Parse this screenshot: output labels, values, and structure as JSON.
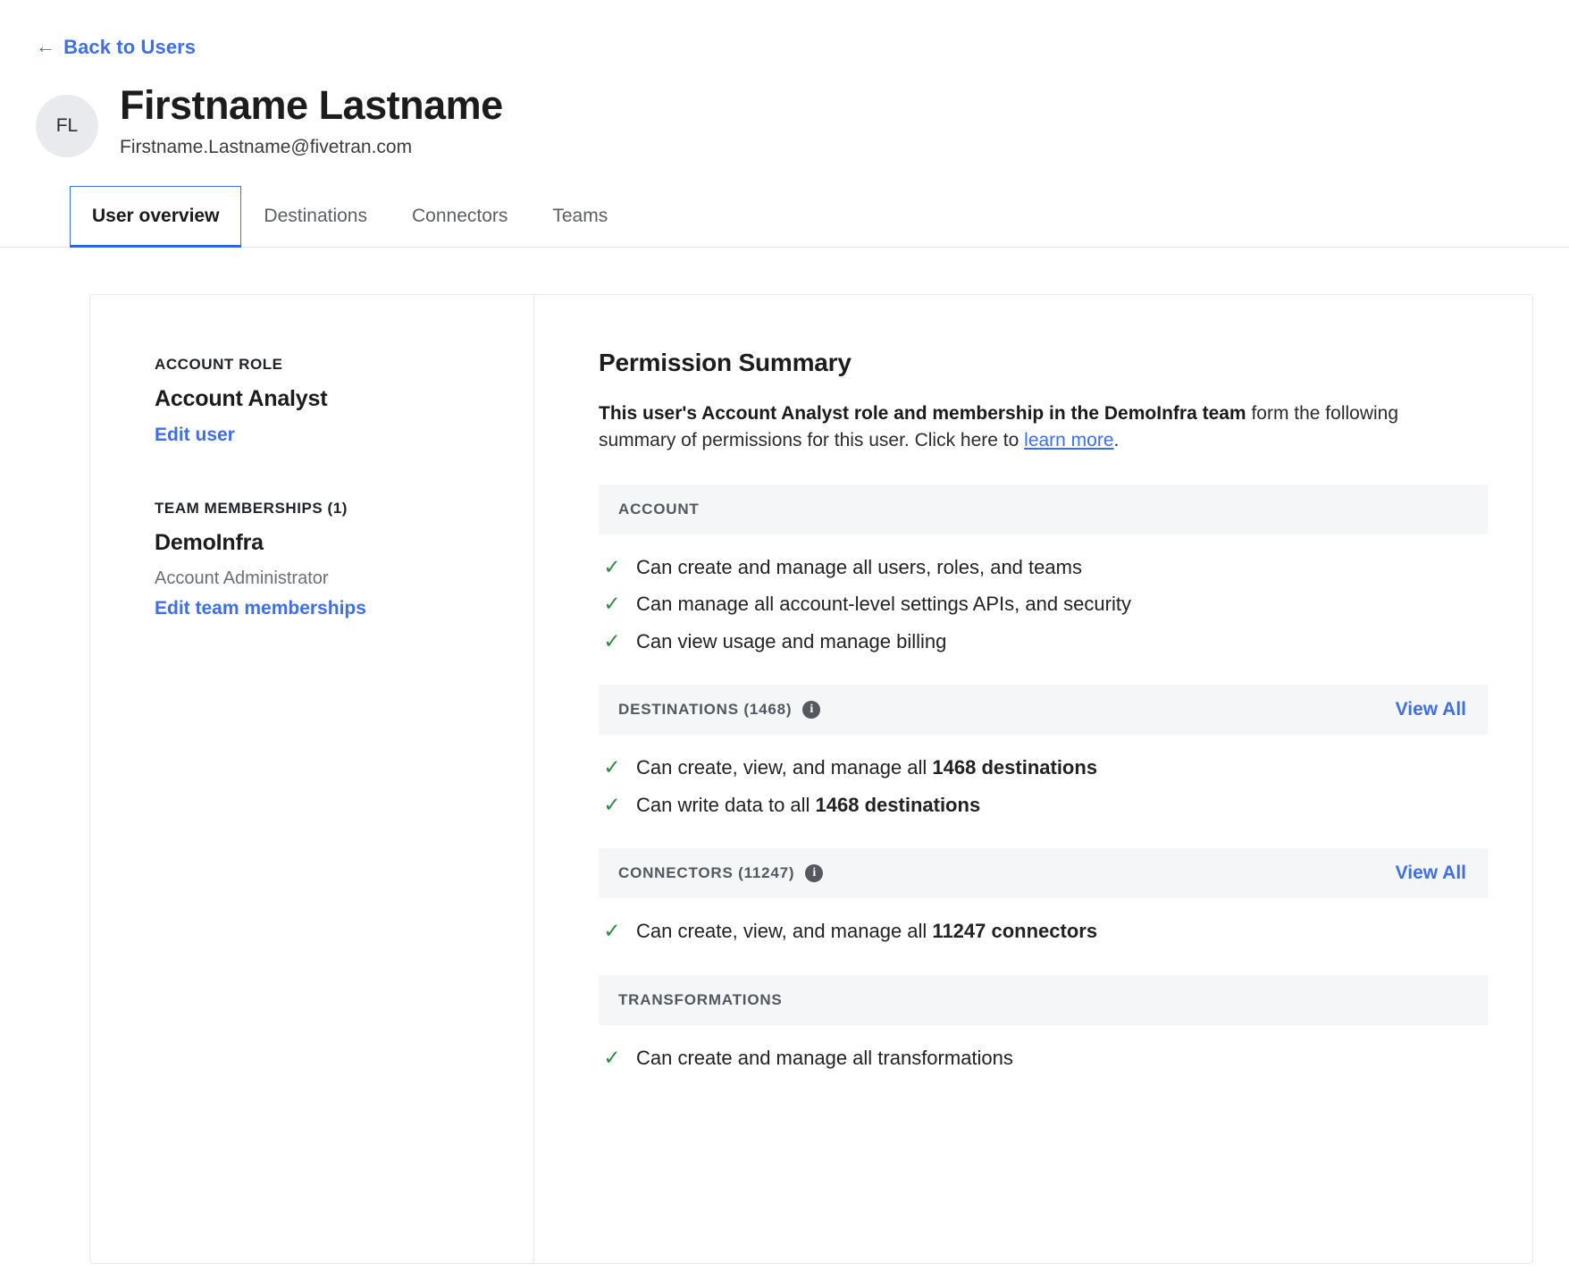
{
  "header": {
    "back_link": "Back to Users",
    "back_arrow_icon": "arrow-left-icon",
    "avatar_initials": "FL",
    "user_name": "Firstname Lastname",
    "user_email": "Firstname.Lastname@fivetran.com"
  },
  "tabs": [
    {
      "label": "User overview",
      "active": true
    },
    {
      "label": "Destinations",
      "active": false
    },
    {
      "label": "Connectors",
      "active": false
    },
    {
      "label": "Teams",
      "active": false
    }
  ],
  "sidebar": {
    "account_role_label": "ACCOUNT ROLE",
    "account_role_value": "Account Analyst",
    "edit_user_link": "Edit user",
    "team_memberships_label": "TEAM MEMBERSHIPS (1)",
    "team_name": "DemoInfra",
    "team_role": "Account Administrator",
    "edit_team_link": "Edit team memberships"
  },
  "permission_summary": {
    "title": "Permission Summary",
    "desc_bold": "This user's Account Analyst role and membership in the DemoInfra team",
    "desc_mid": " form the following summary of permissions for this user. Click here to ",
    "desc_link": "learn more",
    "desc_end": ".",
    "groups": [
      {
        "title": "ACCOUNT",
        "count_suffix": "",
        "has_info_icon": false,
        "view_all": "",
        "bullets": [
          {
            "pre": "Can create and manage all users, roles, and teams",
            "bold": "",
            "post": ""
          },
          {
            "pre": "Can manage all account-level settings APIs, and security",
            "bold": "",
            "post": ""
          },
          {
            "pre": "Can view usage and manage billing",
            "bold": "",
            "post": ""
          }
        ]
      },
      {
        "title": "DESTINATIONS (1468)",
        "has_info_icon": true,
        "view_all": "View All",
        "bullets": [
          {
            "pre": "Can create, view, and manage all ",
            "bold": "1468 destinations",
            "post": ""
          },
          {
            "pre": "Can write data to all ",
            "bold": "1468 destinations",
            "post": ""
          }
        ]
      },
      {
        "title": "CONNECTORS (11247)",
        "has_info_icon": true,
        "view_all": "View All",
        "bullets": [
          {
            "pre": "Can create, view, and manage all ",
            "bold": "11247 connectors",
            "post": ""
          }
        ]
      },
      {
        "title": "TRANSFORMATIONS",
        "has_info_icon": false,
        "view_all": "",
        "bullets": [
          {
            "pre": "Can create and manage all transformations",
            "bold": "",
            "post": ""
          }
        ]
      }
    ]
  },
  "icons": {
    "info": "i",
    "check": "✓",
    "arrow_left": "←"
  },
  "colors": {
    "link_blue": "#3f6fe6",
    "check_green": "#2a8a3e",
    "group_header_bg": "#f5f6f8",
    "avatar_bg": "#e9eaee"
  }
}
